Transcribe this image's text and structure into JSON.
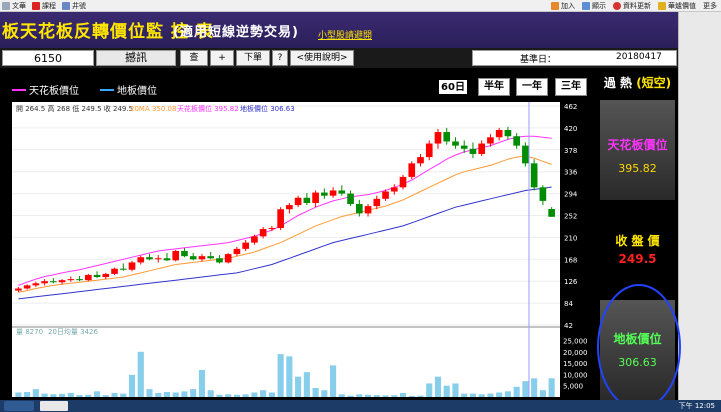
{
  "toolbar": {
    "left": [
      {
        "label": "文華",
        "icon": "file-icon"
      },
      {
        "label": "課程",
        "icon": "course-icon"
      },
      {
        "label": "井號",
        "icon": "grid-icon"
      }
    ],
    "right": [
      {
        "label": "加入",
        "icon": "add-icon"
      },
      {
        "label": "顯示",
        "icon": "display-icon"
      },
      {
        "label": "資料更新",
        "icon": "refresh-icon"
      },
      {
        "label": "華爐價值",
        "icon": "value-icon"
      },
      {
        "label": "更多",
        "icon": "more-icon"
      }
    ]
  },
  "title": {
    "main": "板天花板反轉價位監 控 表",
    "sub": "(適用短線逆勢交易)",
    "tag": "小型股請避開"
  },
  "controls": {
    "stock_code": "6150",
    "stock_name": "撼訊",
    "btn_query": "查",
    "btn_add": "+",
    "btn_order": "下單",
    "btn_help_q": "?",
    "btn_manual": "<使用說明>",
    "date_label": "基準日：",
    "date_value": "20180417"
  },
  "legend": {
    "ceiling": "天花板價位",
    "floor": "地板價位"
  },
  "periods": [
    {
      "label": "60日",
      "active": true
    },
    {
      "label": "半年",
      "active": false
    },
    {
      "label": "一年",
      "active": false
    },
    {
      "label": "三年",
      "active": false
    }
  ],
  "right_panel": {
    "header_a": "過 熱",
    "header_b": "(短空)",
    "ceiling_title": "天花板價位",
    "ceiling_value": "395.82",
    "close_title": "收 盤 價",
    "close_value": "249.5",
    "floor_title": "地板價位",
    "floor_value": "306.63"
  },
  "chart_info": {
    "ohlc": "開 264.5 高 268 低 249.5 收 249.5",
    "ma20": "20MA 350.08",
    "ceiling": "天花板價位 395.82",
    "floor": "地板價位 306.63",
    "vol_info": "量 8270",
    "vol_ma": "20日均量 3426"
  },
  "colors": {
    "up": "#ff0000",
    "down": "#008c00",
    "ceiling_line": "#ff33ff",
    "ma_line": "#ff9933",
    "floor_line": "#3333cc",
    "volume": "#87ceeb",
    "title_yellow": "#ffe600"
  },
  "chart_data": {
    "type": "candlestick",
    "price_axis": {
      "ticks": [
        42,
        84,
        126,
        168,
        210,
        252,
        294,
        336,
        378,
        420,
        462
      ],
      "range": [
        42,
        462
      ]
    },
    "volume_axis": {
      "ticks": [
        5000,
        10000,
        15000,
        20000,
        25000
      ],
      "range": [
        0,
        27000
      ]
    },
    "candles": [
      {
        "o": 108,
        "h": 115,
        "l": 105,
        "c": 112
      },
      {
        "o": 112,
        "h": 120,
        "l": 110,
        "c": 118
      },
      {
        "o": 118,
        "h": 125,
        "l": 115,
        "c": 122
      },
      {
        "o": 122,
        "h": 130,
        "l": 118,
        "c": 126
      },
      {
        "o": 126,
        "h": 132,
        "l": 122,
        "c": 124
      },
      {
        "o": 124,
        "h": 130,
        "l": 120,
        "c": 128
      },
      {
        "o": 128,
        "h": 135,
        "l": 125,
        "c": 130
      },
      {
        "o": 130,
        "h": 136,
        "l": 126,
        "c": 128
      },
      {
        "o": 128,
        "h": 140,
        "l": 126,
        "c": 138
      },
      {
        "o": 138,
        "h": 145,
        "l": 132,
        "c": 134
      },
      {
        "o": 134,
        "h": 142,
        "l": 130,
        "c": 140
      },
      {
        "o": 140,
        "h": 152,
        "l": 138,
        "c": 150
      },
      {
        "o": 150,
        "h": 160,
        "l": 146,
        "c": 148
      },
      {
        "o": 148,
        "h": 165,
        "l": 145,
        "c": 162
      },
      {
        "o": 162,
        "h": 175,
        "l": 158,
        "c": 172
      },
      {
        "o": 172,
        "h": 178,
        "l": 166,
        "c": 168
      },
      {
        "o": 168,
        "h": 176,
        "l": 162,
        "c": 170
      },
      {
        "o": 170,
        "h": 180,
        "l": 165,
        "c": 166
      },
      {
        "o": 166,
        "h": 186,
        "l": 164,
        "c": 184
      },
      {
        "o": 184,
        "h": 190,
        "l": 172,
        "c": 174
      },
      {
        "o": 174,
        "h": 180,
        "l": 166,
        "c": 168
      },
      {
        "o": 168,
        "h": 178,
        "l": 164,
        "c": 174
      },
      {
        "o": 174,
        "h": 182,
        "l": 168,
        "c": 170
      },
      {
        "o": 170,
        "h": 176,
        "l": 160,
        "c": 162
      },
      {
        "o": 162,
        "h": 180,
        "l": 160,
        "c": 178
      },
      {
        "o": 178,
        "h": 192,
        "l": 174,
        "c": 188
      },
      {
        "o": 188,
        "h": 205,
        "l": 184,
        "c": 200
      },
      {
        "o": 200,
        "h": 215,
        "l": 196,
        "c": 212
      },
      {
        "o": 212,
        "h": 230,
        "l": 208,
        "c": 226
      },
      {
        "o": 226,
        "h": 232,
        "l": 222,
        "c": 228
      },
      {
        "o": 228,
        "h": 268,
        "l": 224,
        "c": 264
      },
      {
        "o": 264,
        "h": 276,
        "l": 256,
        "c": 272
      },
      {
        "o": 272,
        "h": 290,
        "l": 268,
        "c": 286
      },
      {
        "o": 286,
        "h": 295,
        "l": 272,
        "c": 276
      },
      {
        "o": 276,
        "h": 300,
        "l": 268,
        "c": 296
      },
      {
        "o": 296,
        "h": 304,
        "l": 284,
        "c": 290
      },
      {
        "o": 290,
        "h": 306,
        "l": 286,
        "c": 300
      },
      {
        "o": 300,
        "h": 310,
        "l": 290,
        "c": 294
      },
      {
        "o": 294,
        "h": 300,
        "l": 270,
        "c": 274
      },
      {
        "o": 274,
        "h": 282,
        "l": 250,
        "c": 256
      },
      {
        "o": 256,
        "h": 274,
        "l": 250,
        "c": 270
      },
      {
        "o": 270,
        "h": 290,
        "l": 264,
        "c": 284
      },
      {
        "o": 284,
        "h": 302,
        "l": 280,
        "c": 298
      },
      {
        "o": 298,
        "h": 312,
        "l": 292,
        "c": 306
      },
      {
        "o": 306,
        "h": 330,
        "l": 302,
        "c": 326
      },
      {
        "o": 326,
        "h": 356,
        "l": 322,
        "c": 352
      },
      {
        "o": 352,
        "h": 370,
        "l": 346,
        "c": 364
      },
      {
        "o": 364,
        "h": 396,
        "l": 358,
        "c": 390
      },
      {
        "o": 390,
        "h": 418,
        "l": 380,
        "c": 412
      },
      {
        "o": 412,
        "h": 420,
        "l": 388,
        "c": 394
      },
      {
        "o": 394,
        "h": 402,
        "l": 380,
        "c": 386
      },
      {
        "o": 386,
        "h": 396,
        "l": 372,
        "c": 380
      },
      {
        "o": 380,
        "h": 392,
        "l": 362,
        "c": 370
      },
      {
        "o": 370,
        "h": 396,
        "l": 366,
        "c": 390
      },
      {
        "o": 390,
        "h": 408,
        "l": 384,
        "c": 402
      },
      {
        "o": 402,
        "h": 420,
        "l": 396,
        "c": 416
      },
      {
        "o": 416,
        "h": 422,
        "l": 398,
        "c": 404
      },
      {
        "o": 404,
        "h": 410,
        "l": 380,
        "c": 386
      },
      {
        "o": 386,
        "h": 392,
        "l": 346,
        "c": 352
      },
      {
        "o": 352,
        "h": 360,
        "l": 300,
        "c": 306
      },
      {
        "o": 306,
        "h": 310,
        "l": 272,
        "c": 280
      },
      {
        "o": 264.5,
        "h": 268,
        "l": 249.5,
        "c": 249.5
      }
    ],
    "volumes": [
      2000,
      2200,
      3500,
      1500,
      1200,
      1400,
      1800,
      900,
      1000,
      2500,
      800,
      1800,
      1500,
      9800,
      20000,
      3500,
      1800,
      2200,
      2000,
      2500,
      3500,
      12000,
      3000,
      1000,
      1200,
      1000,
      1200,
      2000,
      3000,
      2000,
      19000,
      18000,
      9000,
      11000,
      4000,
      3000,
      14000,
      1200,
      600,
      1200,
      1000,
      900,
      700,
      800,
      1800,
      500,
      600,
      6000,
      9000,
      5000,
      6000,
      1500,
      1500,
      1200,
      1500,
      2000,
      2500,
      4500,
      7000,
      8270,
      3000,
      8270
    ],
    "ceiling_line": [
      118,
      124,
      130,
      135,
      138,
      142,
      145,
      148,
      152,
      156,
      160,
      164,
      168,
      172,
      176,
      180,
      184,
      186,
      188,
      190,
      192,
      194,
      196,
      198,
      200,
      204,
      208,
      212,
      218,
      224,
      232,
      242,
      252,
      260,
      268,
      274,
      280,
      284,
      288,
      290,
      292,
      296,
      300,
      306,
      312,
      320,
      330,
      340,
      350,
      360,
      368,
      374,
      378,
      382,
      386,
      392,
      398,
      402,
      404,
      404,
      402,
      400
    ],
    "ma_line": [
      105,
      108,
      112,
      115,
      118,
      120,
      122,
      124,
      126,
      128,
      130,
      132,
      134,
      138,
      142,
      146,
      150,
      154,
      158,
      160,
      162,
      164,
      166,
      168,
      170,
      174,
      178,
      182,
      188,
      194,
      200,
      208,
      216,
      224,
      232,
      238,
      244,
      250,
      254,
      258,
      262,
      266,
      270,
      276,
      282,
      290,
      298,
      306,
      314,
      322,
      330,
      336,
      340,
      344,
      348,
      354,
      360,
      364,
      366,
      362,
      356,
      350
    ],
    "floor_line": [
      92,
      94,
      96,
      98,
      100,
      102,
      104,
      106,
      108,
      110,
      112,
      114,
      116,
      118,
      120,
      122,
      124,
      126,
      128,
      130,
      132,
      134,
      136,
      138,
      140,
      142,
      146,
      150,
      154,
      158,
      164,
      170,
      176,
      182,
      188,
      194,
      200,
      204,
      208,
      212,
      216,
      220,
      224,
      228,
      232,
      238,
      244,
      250,
      256,
      262,
      268,
      272,
      276,
      280,
      284,
      288,
      292,
      296,
      300,
      302,
      304,
      306.63
    ]
  }
}
